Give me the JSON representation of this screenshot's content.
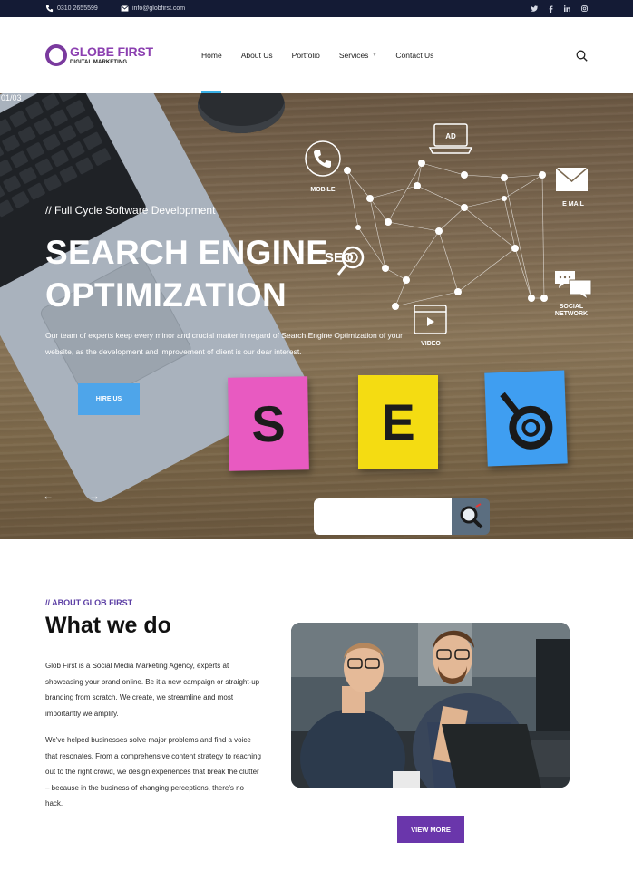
{
  "topbar": {
    "phone": "0310 2655599",
    "email": "info@globfirst.com",
    "social_icons": [
      "twitter-icon",
      "facebook-icon",
      "linkedin-icon",
      "instagram-icon"
    ]
  },
  "logo": {
    "title": "GLOBE FIRST",
    "subtitle": "DIGITAL MARKETING"
  },
  "nav": {
    "items": [
      {
        "label": "Home"
      },
      {
        "label": "About Us"
      },
      {
        "label": "Portfolio"
      },
      {
        "label": "Services",
        "caret": "▼"
      },
      {
        "label": "Contact Us"
      }
    ]
  },
  "hero": {
    "counter": "01/03",
    "kicker": "// Full Cycle Software Development",
    "headline_line1": "SEARCH ENGINE",
    "headline_line2": "OPTIMIZATION",
    "description": "Our team of experts keep every minor and crucial matter in regard of Search Engine Optimization of your website, as the development and improvement of client is our dear interest.",
    "button": "HIRE US",
    "prev_arrow": "←",
    "next_arrow": "→",
    "graph_labels": {
      "mobile": "MOBILE",
      "ad": "AD",
      "email": "E MAIL",
      "seo": "SEO",
      "video": "VIDEO",
      "social": "SOCIAL",
      "network": "NETWORK"
    },
    "notes": [
      "S",
      "E",
      "O"
    ]
  },
  "about": {
    "kicker": "// ABOUT GLOB FIRST",
    "title": "What we do",
    "paragraph1": "Glob First is a Social Media Marketing Agency, experts at showcasing your brand online. Be it a new campaign or straight-up branding from scratch. We create, we streamline and most importantly we amplify.",
    "paragraph2": "We've helped businesses solve major problems and find a voice that resonates. From a comprehensive content strategy to reaching out to the right crowd, we design experiences that break the clutter – because in the business of changing perceptions, there's no hack.",
    "button": "VIEW MORE"
  },
  "colors": {
    "topbar": "#141b35",
    "brand_purple": "#6a36ab",
    "accent_blue": "#4ea5ea"
  }
}
